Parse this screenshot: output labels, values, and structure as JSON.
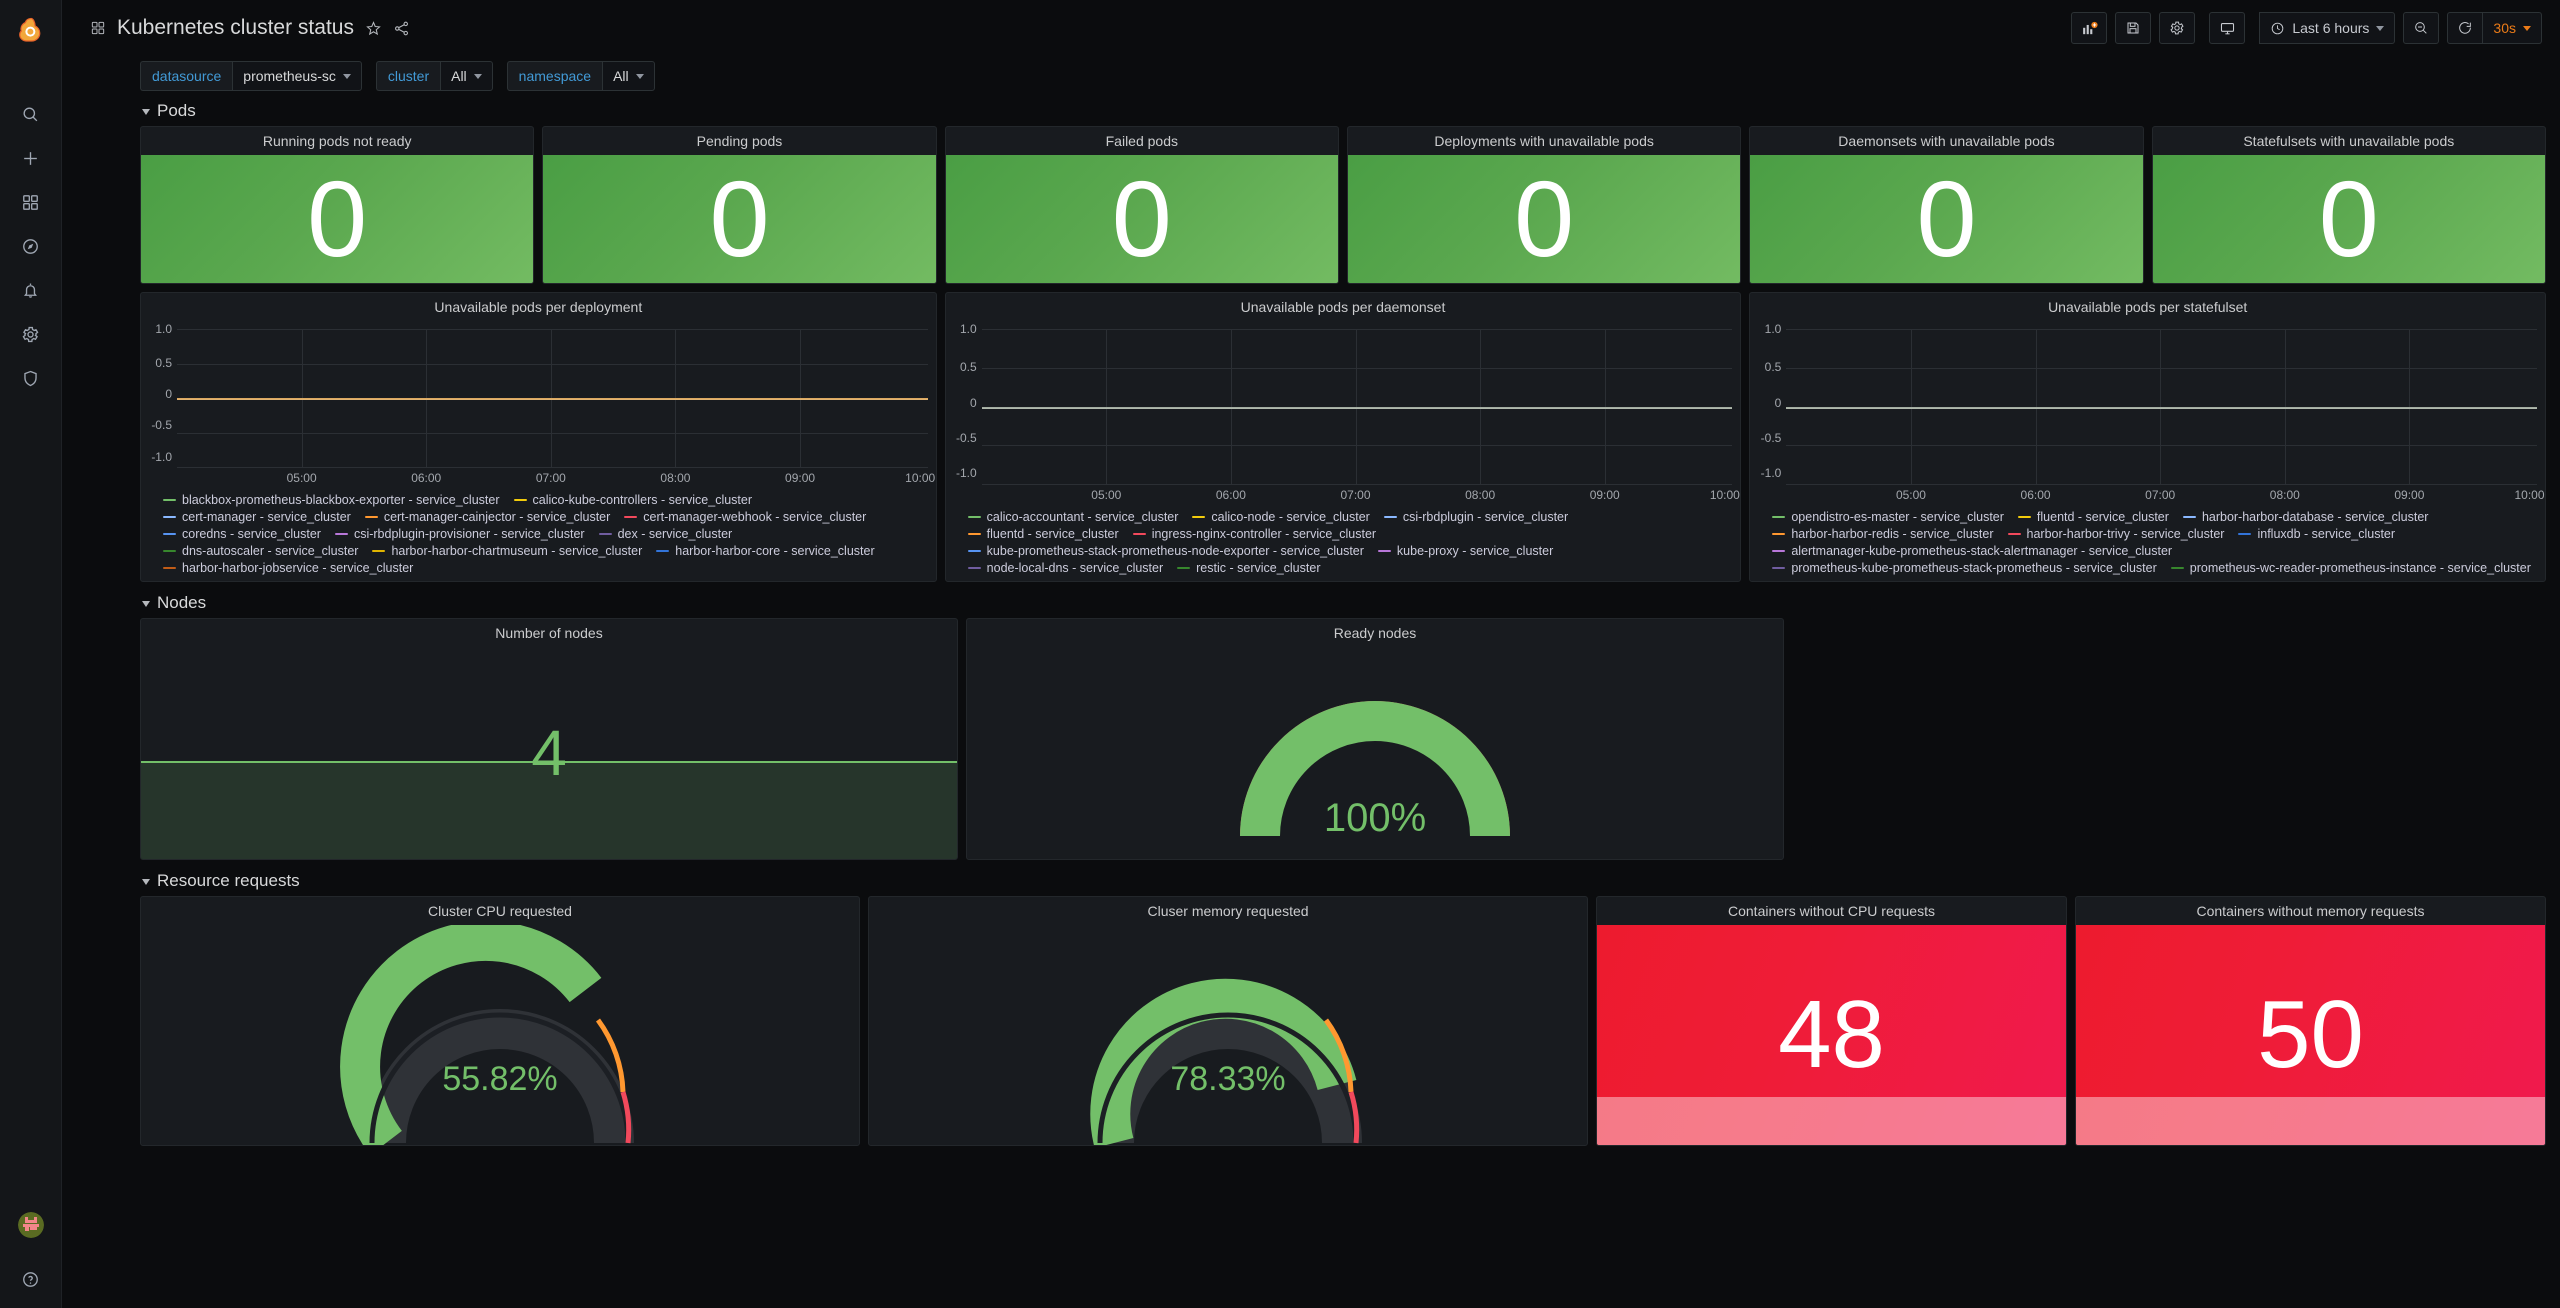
{
  "app": {
    "logo_icon": "grafana-logo-icon",
    "nav_icons": [
      "search-icon",
      "plus-icon",
      "dashboards-grid-icon",
      "explore-compass-icon",
      "alert-bell-icon",
      "configuration-gear-icon",
      "shield-admin-icon"
    ],
    "help_icon": "help-question-icon",
    "avatar": "user-avatar"
  },
  "header": {
    "dashboard_icon": "dashboard-grid-icon",
    "title": "Kubernetes cluster status",
    "star_icon": "star-icon",
    "share_icon": "share-icon",
    "toolbar": {
      "add_panel_icon": "add-panel-icon",
      "save_icon": "save-dashboard-icon",
      "settings_icon": "dashboard-settings-gear-icon",
      "tv_icon": "cycle-view-mode-icon",
      "time_clock_icon": "clock-icon",
      "time_range": "Last 6 hours",
      "zoom_out_icon": "zoom-out-icon",
      "refresh_icon": "refresh-icon",
      "refresh_interval": "30s"
    }
  },
  "variables": [
    {
      "label": "datasource",
      "value": "prometheus-sc"
    },
    {
      "label": "cluster",
      "value": "All"
    },
    {
      "label": "namespace",
      "value": "All"
    }
  ],
  "sections": [
    {
      "name": "Pods"
    },
    {
      "name": "Nodes"
    },
    {
      "name": "Resource requests"
    }
  ],
  "pod_stats": [
    {
      "title": "Running pods not ready",
      "value": "0"
    },
    {
      "title": "Pending pods",
      "value": "0"
    },
    {
      "title": "Failed pods",
      "value": "0"
    },
    {
      "title": "Deployments with unavailable pods",
      "value": "0"
    },
    {
      "title": "Daemonsets with unavailable pods",
      "value": "0"
    },
    {
      "title": "Statefulsets with unavailable pods",
      "value": "0"
    }
  ],
  "nodes": {
    "count_title": "Number of nodes",
    "count_value": "4",
    "ready_title": "Ready nodes",
    "ready_value": "100%"
  },
  "resources": {
    "cpu_title": "Cluster CPU requested",
    "cpu_value": "55.82%",
    "mem_title": "Cluser memory requested",
    "mem_value": "78.33%",
    "no_cpu_title": "Containers without CPU requests",
    "no_cpu_value": "48",
    "no_mem_title": "Containers without memory requests",
    "no_mem_value": "50"
  },
  "colors": {
    "green": "#73bf69",
    "red": "#f2495c",
    "orange": "#ff9830",
    "blue": "#429ad6",
    "accent_orange": "#eb7b18"
  },
  "chart_data": [
    {
      "type": "line",
      "title": "Unavailable pods per deployment",
      "xlabel": "",
      "ylabel": "",
      "ylim": [
        -1.0,
        1.0
      ],
      "yticks": [
        "1.0",
        "0.5",
        "0",
        "-0.5",
        "-1.0"
      ],
      "xticks": [
        "05:00",
        "06:00",
        "07:00",
        "08:00",
        "09:00",
        "10:00"
      ],
      "grid": true,
      "legend_position": "bottom",
      "series": [
        {
          "name": "blackbox-prometheus-blackbox-exporter - service_cluster",
          "color": "#73bf69",
          "values": [
            0,
            0,
            0,
            0,
            0,
            0
          ]
        },
        {
          "name": "calico-kube-controllers - service_cluster",
          "color": "#f2cc0c",
          "values": [
            0,
            0,
            0,
            0,
            0,
            0
          ]
        },
        {
          "name": "cert-manager - service_cluster",
          "color": "#8ab8ff",
          "values": [
            0,
            0,
            0,
            0,
            0,
            0
          ]
        },
        {
          "name": "cert-manager-cainjector - service_cluster",
          "color": "#ff9830",
          "values": [
            0,
            0,
            0,
            0,
            0,
            0
          ]
        },
        {
          "name": "cert-manager-webhook - service_cluster",
          "color": "#f2495c",
          "values": [
            0,
            0,
            0,
            0,
            0,
            0
          ]
        },
        {
          "name": "coredns - service_cluster",
          "color": "#5794f2",
          "values": [
            0,
            0,
            0,
            0,
            0,
            0
          ]
        },
        {
          "name": "csi-rbdplugin-provisioner - service_cluster",
          "color": "#b877d9",
          "values": [
            0,
            0,
            0,
            0,
            0,
            0
          ]
        },
        {
          "name": "dex - service_cluster",
          "color": "#705da0",
          "values": [
            0,
            0,
            0,
            0,
            0,
            0
          ]
        },
        {
          "name": "dns-autoscaler - service_cluster",
          "color": "#37872d",
          "values": [
            0,
            0,
            0,
            0,
            0,
            0
          ]
        },
        {
          "name": "harbor-harbor-chartmuseum - service_cluster",
          "color": "#e0b400",
          "values": [
            0,
            0,
            0,
            0,
            0,
            0
          ]
        },
        {
          "name": "harbor-harbor-core - service_cluster",
          "color": "#3274d9",
          "values": [
            0,
            0,
            0,
            0,
            0,
            0
          ]
        },
        {
          "name": "harbor-harbor-jobservice - service_cluster",
          "color": "#c15c17",
          "values": [
            0,
            0,
            0,
            0,
            0,
            0
          ]
        }
      ]
    },
    {
      "type": "line",
      "title": "Unavailable pods per daemonset",
      "xlabel": "",
      "ylabel": "",
      "ylim": [
        -1.0,
        1.0
      ],
      "yticks": [
        "1.0",
        "0.5",
        "0",
        "-0.5",
        "-1.0"
      ],
      "xticks": [
        "05:00",
        "06:00",
        "07:00",
        "08:00",
        "09:00",
        "10:00"
      ],
      "grid": true,
      "legend_position": "bottom",
      "series": [
        {
          "name": "calico-accountant - service_cluster",
          "color": "#73bf69",
          "values": [
            0,
            0,
            0,
            0,
            0,
            0
          ]
        },
        {
          "name": "calico-node - service_cluster",
          "color": "#f2cc0c",
          "values": [
            0,
            0,
            0,
            0,
            0,
            0
          ]
        },
        {
          "name": "csi-rbdplugin - service_cluster",
          "color": "#8ab8ff",
          "values": [
            0,
            0,
            0,
            0,
            0,
            0
          ]
        },
        {
          "name": "fluentd - service_cluster",
          "color": "#ff9830",
          "values": [
            0,
            0,
            0,
            0,
            0,
            0
          ]
        },
        {
          "name": "ingress-nginx-controller - service_cluster",
          "color": "#f2495c",
          "values": [
            0,
            0,
            0,
            0,
            0,
            0
          ]
        },
        {
          "name": "kube-prometheus-stack-prometheus-node-exporter - service_cluster",
          "color": "#5794f2",
          "values": [
            0,
            0,
            0,
            0,
            0,
            0
          ]
        },
        {
          "name": "kube-proxy - service_cluster",
          "color": "#b877d9",
          "values": [
            0,
            0,
            0,
            0,
            0,
            0
          ]
        },
        {
          "name": "node-local-dns - service_cluster",
          "color": "#705da0",
          "values": [
            0,
            0,
            0,
            0,
            0,
            0
          ]
        },
        {
          "name": "restic - service_cluster",
          "color": "#37872d",
          "values": [
            0,
            0,
            0,
            0,
            0,
            0
          ]
        }
      ]
    },
    {
      "type": "line",
      "title": "Unavailable pods per statefulset",
      "xlabel": "",
      "ylabel": "",
      "ylim": [
        -1.0,
        1.0
      ],
      "yticks": [
        "1.0",
        "0.5",
        "0",
        "-0.5",
        "-1.0"
      ],
      "xticks": [
        "05:00",
        "06:00",
        "07:00",
        "08:00",
        "09:00",
        "10:00"
      ],
      "grid": true,
      "legend_position": "bottom",
      "series": [
        {
          "name": "opendistro-es-master - service_cluster",
          "color": "#73bf69",
          "values": [
            0,
            0,
            0,
            0,
            0,
            0
          ]
        },
        {
          "name": "fluentd - service_cluster",
          "color": "#f2cc0c",
          "values": [
            0,
            0,
            0,
            0,
            0,
            0
          ]
        },
        {
          "name": "harbor-harbor-database - service_cluster",
          "color": "#8ab8ff",
          "values": [
            0,
            0,
            0,
            0,
            0,
            0
          ]
        },
        {
          "name": "harbor-harbor-redis - service_cluster",
          "color": "#ff9830",
          "values": [
            0,
            0,
            0,
            0,
            0,
            0
          ]
        },
        {
          "name": "harbor-harbor-trivy - service_cluster",
          "color": "#f2495c",
          "values": [
            0,
            0,
            0,
            0,
            0,
            0
          ]
        },
        {
          "name": "influxdb - service_cluster",
          "color": "#3274d9",
          "values": [
            0,
            0,
            0,
            0,
            0,
            0
          ]
        },
        {
          "name": "alertmanager-kube-prometheus-stack-alertmanager - service_cluster",
          "color": "#b877d9",
          "values": [
            0,
            0,
            0,
            0,
            0,
            0
          ]
        },
        {
          "name": "prometheus-kube-prometheus-stack-prometheus - service_cluster",
          "color": "#705da0",
          "values": [
            0,
            0,
            0,
            0,
            0,
            0
          ]
        },
        {
          "name": "prometheus-wc-reader-prometheus-instance - service_cluster",
          "color": "#37872d",
          "values": [
            0,
            0,
            0,
            0,
            0,
            0
          ]
        }
      ]
    },
    {
      "type": "gauge",
      "title": "Ready nodes",
      "value": 100,
      "unit": "%",
      "min": 0,
      "max": 100,
      "thresholds": [
        {
          "value": 0,
          "color": "#f2495c"
        },
        {
          "value": 90,
          "color": "#73bf69"
        }
      ]
    },
    {
      "type": "gauge",
      "title": "Cluster CPU requested",
      "value": 55.82,
      "unit": "%",
      "min": 0,
      "max": 100,
      "thresholds": [
        {
          "value": 0,
          "color": "#73bf69"
        },
        {
          "value": 80,
          "color": "#ff9830"
        },
        {
          "value": 90,
          "color": "#f2495c"
        }
      ]
    },
    {
      "type": "gauge",
      "title": "Cluser memory requested",
      "value": 78.33,
      "unit": "%",
      "min": 0,
      "max": 100,
      "thresholds": [
        {
          "value": 0,
          "color": "#73bf69"
        },
        {
          "value": 80,
          "color": "#ff9830"
        },
        {
          "value": 90,
          "color": "#f2495c"
        }
      ]
    }
  ]
}
